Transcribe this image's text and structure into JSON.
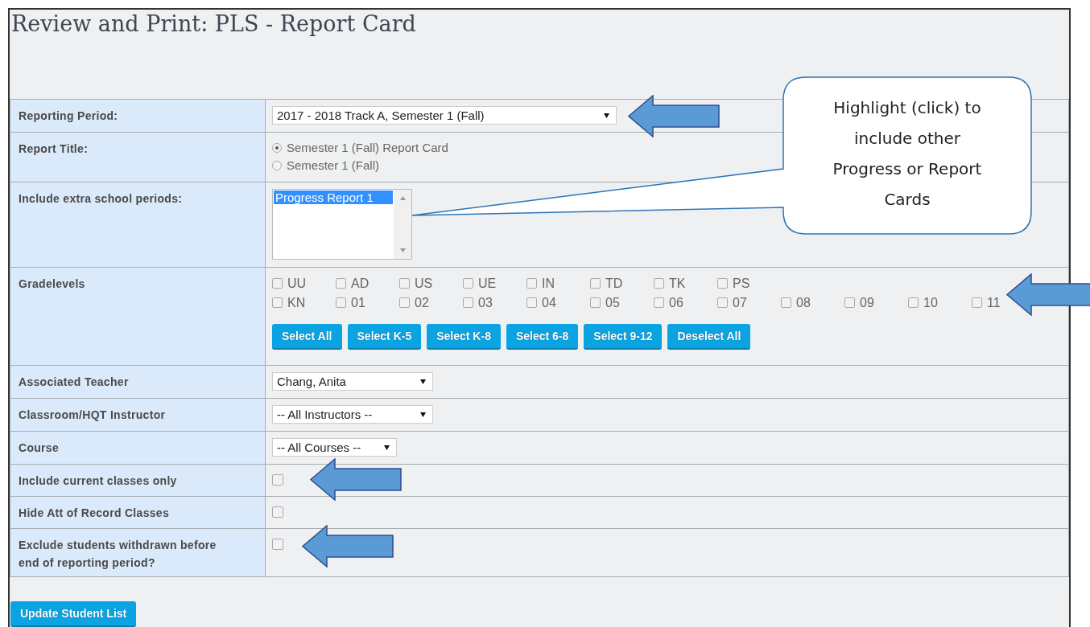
{
  "title": "Review and Print:  PLS - Report Card",
  "rows": [
    {
      "kind": "select",
      "label": "Reporting Period:",
      "value": "2017 - 2018 Track A, Semester 1 (Fall)"
    },
    {
      "kind": "radio",
      "label": "Report Title:",
      "options": [
        {
          "label": "Semester 1 (Fall) Report Card",
          "selected": true
        },
        {
          "label": "Semester 1 (Fall)",
          "selected": false
        }
      ]
    },
    {
      "kind": "listbox",
      "label": "Include extra school periods:",
      "items": [
        {
          "label": "Progress Report 1",
          "selected": true
        }
      ]
    },
    {
      "kind": "grades",
      "label": "Gradelevels",
      "lines": [
        [
          {
            "label": "UU",
            "checked": false
          },
          {
            "label": "AD",
            "checked": false
          },
          {
            "label": "US",
            "checked": false
          },
          {
            "label": "UE",
            "checked": false
          },
          {
            "label": "IN",
            "checked": false
          },
          {
            "label": "TD",
            "checked": false
          },
          {
            "label": "TK",
            "checked": false
          },
          {
            "label": "PS",
            "checked": false
          }
        ],
        [
          {
            "label": "KN",
            "checked": false
          },
          {
            "label": "01",
            "checked": false
          },
          {
            "label": "02",
            "checked": false
          },
          {
            "label": "03",
            "checked": false
          },
          {
            "label": "04",
            "checked": false
          },
          {
            "label": "05",
            "checked": false
          },
          {
            "label": "06",
            "checked": false
          },
          {
            "label": "07",
            "checked": false
          },
          {
            "label": "08",
            "checked": false
          },
          {
            "label": "09",
            "checked": false
          },
          {
            "label": "10",
            "checked": false
          },
          {
            "label": "11",
            "checked": false
          }
        ]
      ],
      "buttons": [
        "Select All",
        "Select K-5",
        "Select K-8",
        "Select 6-8",
        "Select 9-12",
        "Deselect All"
      ]
    },
    {
      "kind": "select",
      "label": "Associated Teacher",
      "value": "Chang, Anita"
    },
    {
      "kind": "select",
      "label": "Classroom/HQT Instructor",
      "value": "-- All Instructors --"
    },
    {
      "kind": "select",
      "label": "Course",
      "value": "-- All Courses --"
    },
    {
      "kind": "checkbox",
      "label": "Include current classes only",
      "checked": false
    },
    {
      "kind": "checkbox",
      "label": "Hide Att of Record Classes",
      "checked": false
    },
    {
      "kind": "checkbox",
      "label": "Exclude students withdrawn before end of reporting period?",
      "checked": false
    }
  ],
  "buttons": [
    "Update Student List"
  ],
  "callout": {
    "text": "Highlight (click) to include other Progress or Report Cards"
  }
}
